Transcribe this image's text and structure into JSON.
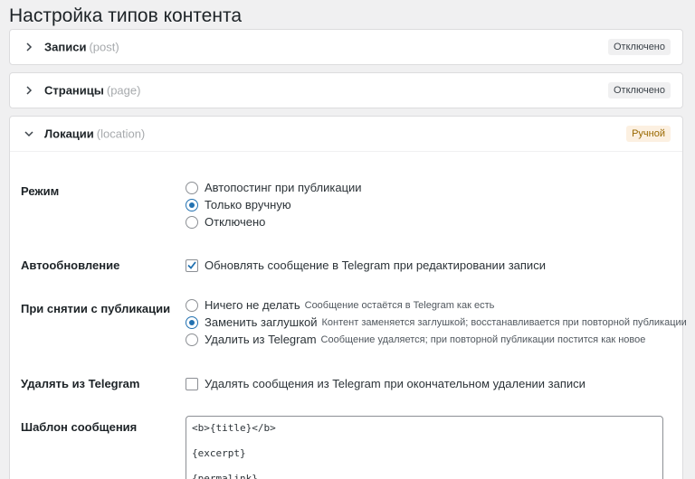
{
  "page": {
    "title": "Настройка типов контента"
  },
  "panels": [
    {
      "title": "Записи",
      "slug": "(post)",
      "badge": "Отключено",
      "expanded": false
    },
    {
      "title": "Страницы",
      "slug": "(page)",
      "badge": "Отключено",
      "expanded": false
    },
    {
      "title": "Локации",
      "slug": "(location)",
      "badge": "Ручной",
      "expanded": true
    }
  ],
  "settings": {
    "mode": {
      "label": "Режим",
      "options": [
        "Автопостинг при публикации",
        "Только вручную",
        "Отключено"
      ],
      "selected": "Только вручную"
    },
    "autoupdate": {
      "label": "Автообновление",
      "checkbox_label": "Обновлять сообщение в Telegram при редактировании записи",
      "checked": true
    },
    "unpublish": {
      "label": "При снятии с публикации",
      "options": [
        {
          "label": "Ничего не делать",
          "hint": "Сообщение остаётся в Telegram как есть"
        },
        {
          "label": "Заменить заглушкой",
          "hint": "Контент заменяется заглушкой; восстанавливается при повторной публикации"
        },
        {
          "label": "Удалить из Telegram",
          "hint": "Сообщение удаляется; при повторной публикации постится как новое"
        }
      ],
      "selected": "Заменить заглушкой"
    },
    "delete": {
      "label": "Удалять из Telegram",
      "checkbox_label": "Удалять сообщения из Telegram при окончательном удалении записи",
      "checked": false
    },
    "template": {
      "label": "Шаблон сообщения",
      "lines": [
        "<b>{title}</b>",
        "{excerpt}",
        "{permalink}"
      ]
    }
  },
  "colors": {
    "accent": "#2271b1",
    "manual_badge_bg": "#fcf0e1",
    "manual_badge_text": "#996800"
  }
}
